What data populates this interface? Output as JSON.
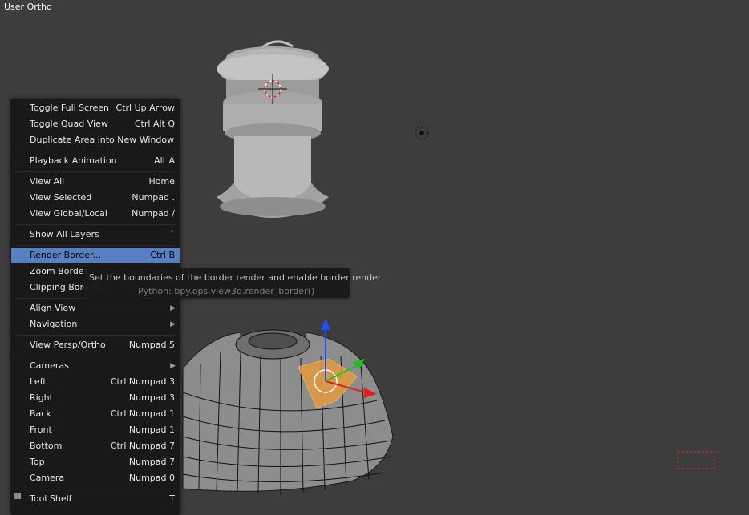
{
  "viewport": {
    "label": "User Ortho"
  },
  "menu": {
    "items": [
      {
        "label": "Toggle Full Screen",
        "shortcut": "Ctrl Up Arrow"
      },
      {
        "label": "Toggle Quad View",
        "shortcut": "Ctrl Alt Q"
      },
      {
        "label": "Duplicate Area into New Window",
        "shortcut": ""
      },
      {
        "label": "Playback Animation",
        "shortcut": "Alt A"
      },
      {
        "label": "View All",
        "shortcut": "Home"
      },
      {
        "label": "View Selected",
        "shortcut": "Numpad ."
      },
      {
        "label": "View Global/Local",
        "shortcut": "Numpad /"
      },
      {
        "label": "Show All Layers",
        "shortcut": "`"
      },
      {
        "label": "Render Border...",
        "shortcut": "Ctrl B"
      },
      {
        "label": "Zoom Border...",
        "shortcut": ""
      },
      {
        "label": "Clipping Border...",
        "shortcut": ""
      },
      {
        "label": "Align View",
        "shortcut": ""
      },
      {
        "label": "Navigation",
        "shortcut": ""
      },
      {
        "label": "View Persp/Ortho",
        "shortcut": "Numpad 5"
      },
      {
        "label": "Cameras",
        "shortcut": ""
      },
      {
        "label": "Left",
        "shortcut": "Ctrl Numpad 3"
      },
      {
        "label": "Right",
        "shortcut": "Numpad 3"
      },
      {
        "label": "Back",
        "shortcut": "Ctrl Numpad 1"
      },
      {
        "label": "Front",
        "shortcut": "Numpad 1"
      },
      {
        "label": "Bottom",
        "shortcut": "Ctrl Numpad 7"
      },
      {
        "label": "Top",
        "shortcut": "Numpad 7"
      },
      {
        "label": "Camera",
        "shortcut": "Numpad 0"
      },
      {
        "label": "Tool Shelf",
        "shortcut": "T"
      }
    ]
  },
  "tooltip": {
    "description": "Set the boundaries of the border render and enable border render",
    "python": "Python: bpy.ops.view3d.render_border()"
  },
  "colors": {
    "background": "#3d3d3d",
    "menu_bg": "#191919",
    "highlight": "#5680c2",
    "selection_orange": "#f0a040",
    "axis_z": "#2050ff",
    "axis_x": "#e02020",
    "axis_y": "#20c020"
  },
  "icons": [
    "manipulator-icon",
    "lamp-icon",
    "cursor-icon",
    "submenu-arrow-icon",
    "tool-shelf-icon"
  ]
}
